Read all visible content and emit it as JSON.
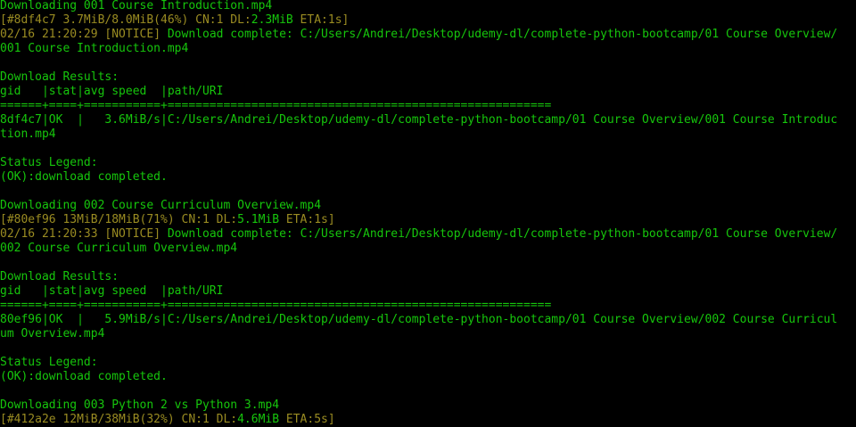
{
  "colors": {
    "green": "#16c60c",
    "olive": "#9a8c22",
    "background": "#000000"
  },
  "lines": [
    [
      {
        "t": "Downloading 001 Course Introduction.mp4",
        "c": "g"
      }
    ],
    [
      {
        "t": "[#8df4c7 3.7MiB/8.0MiB(46%) CN:1 DL:",
        "c": "y"
      },
      {
        "t": "2.3MiB",
        "c": "g"
      },
      {
        "t": " ETA:1s]",
        "c": "y"
      }
    ],
    [
      {
        "t": "02/16 21:20:29 ",
        "c": "y"
      },
      {
        "t": "[NOTICE]",
        "c": "y"
      },
      {
        "t": " Download complete: C:/Users/Andrei/Desktop/udemy-dl/complete-python-bootcamp/01 Course Overview/",
        "c": "g"
      }
    ],
    [
      {
        "t": "001 Course Introduction.mp4",
        "c": "g"
      }
    ],
    [
      {
        "t": "",
        "c": "g"
      }
    ],
    [
      {
        "t": "Download Results:",
        "c": "g"
      }
    ],
    [
      {
        "t": "gid   |stat|avg speed  |path/URI",
        "c": "g"
      }
    ],
    [
      {
        "t": "======+====+===========+=======================================================",
        "c": "g"
      }
    ],
    [
      {
        "t": "8df4c7|OK  |   3.6MiB/s|C:/Users/Andrei/Desktop/udemy-dl/complete-python-bootcamp/01 Course Overview/001 Course Introduc",
        "c": "g"
      }
    ],
    [
      {
        "t": "tion.mp4",
        "c": "g"
      }
    ],
    [
      {
        "t": "",
        "c": "g"
      }
    ],
    [
      {
        "t": "Status Legend:",
        "c": "g"
      }
    ],
    [
      {
        "t": "(OK):download completed.",
        "c": "g"
      }
    ],
    [
      {
        "t": "",
        "c": "g"
      }
    ],
    [
      {
        "t": "Downloading 002 Course Curriculum Overview.mp4",
        "c": "g"
      }
    ],
    [
      {
        "t": "[#80ef96 13MiB/18MiB(71%) CN:1 DL:",
        "c": "y"
      },
      {
        "t": "5.1MiB",
        "c": "g"
      },
      {
        "t": " ETA:1s]",
        "c": "y"
      }
    ],
    [
      {
        "t": "02/16 21:20:33 ",
        "c": "y"
      },
      {
        "t": "[NOTICE]",
        "c": "y"
      },
      {
        "t": " Download complete: C:/Users/Andrei/Desktop/udemy-dl/complete-python-bootcamp/01 Course Overview/",
        "c": "g"
      }
    ],
    [
      {
        "t": "002 Course Curriculum Overview.mp4",
        "c": "g"
      }
    ],
    [
      {
        "t": "",
        "c": "g"
      }
    ],
    [
      {
        "t": "Download Results:",
        "c": "g"
      }
    ],
    [
      {
        "t": "gid   |stat|avg speed  |path/URI",
        "c": "g"
      }
    ],
    [
      {
        "t": "======+====+===========+=======================================================",
        "c": "g"
      }
    ],
    [
      {
        "t": "80ef96|OK  |   5.9MiB/s|C:/Users/Andrei/Desktop/udemy-dl/complete-python-bootcamp/01 Course Overview/002 Course Curricul",
        "c": "g"
      }
    ],
    [
      {
        "t": "um Overview.mp4",
        "c": "g"
      }
    ],
    [
      {
        "t": "",
        "c": "g"
      }
    ],
    [
      {
        "t": "Status Legend:",
        "c": "g"
      }
    ],
    [
      {
        "t": "(OK):download completed.",
        "c": "g"
      }
    ],
    [
      {
        "t": "",
        "c": "g"
      }
    ],
    [
      {
        "t": "Downloading 003 Python 2 vs Python 3.mp4",
        "c": "g"
      }
    ],
    [
      {
        "t": "[#412a2e 12MiB/38MiB(32%) CN:1 DL:",
        "c": "y"
      },
      {
        "t": "4.6MiB",
        "c": "g"
      },
      {
        "t": " ETA:5s]",
        "c": "y"
      }
    ]
  ]
}
